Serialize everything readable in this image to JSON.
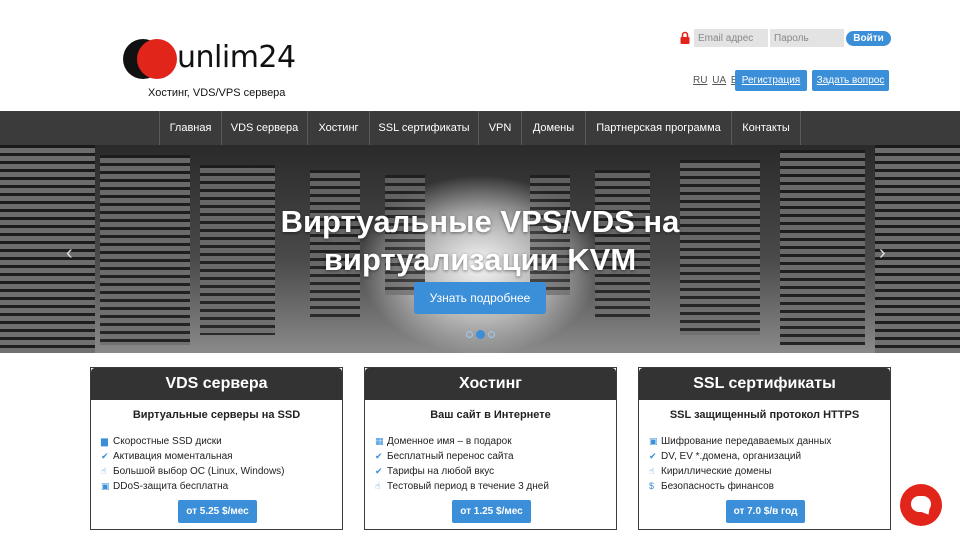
{
  "header": {
    "logo_text": "unlim24",
    "tagline": "Хостинг, VDS/VPS сервера",
    "login": {
      "email_placeholder": "Email адрес",
      "password_placeholder": "Пароль",
      "submit_label": "Войти"
    },
    "languages": [
      "RU",
      "UA",
      "EN"
    ],
    "register_label": "Регистрация",
    "ask_label": "Задать вопрос"
  },
  "nav": {
    "items": [
      "Главная",
      "VDS сервера",
      "Хостинг",
      "SSL сертификаты",
      "VPN",
      "Домены",
      "Партнерская программа",
      "Контакты"
    ]
  },
  "hero": {
    "title_line1": "Виртуальные VPS/VDS на",
    "title_line2": "виртуализации KVM",
    "button_label": "Узнать подробнее",
    "prev_icon": "‹",
    "next_icon": "›"
  },
  "cards": [
    {
      "title": "VDS сервера",
      "subtitle": "Виртуальные серверы на SSD",
      "features": [
        {
          "icon": "drive-icon",
          "glyph": "▆",
          "text": "Скоростные SSD диски"
        },
        {
          "icon": "check-icon",
          "glyph": "✔",
          "text": "Активация моментальная"
        },
        {
          "icon": "thumbs-up-icon",
          "glyph": "☝",
          "text": "Большой выбор ОС (Linux, Windows)"
        },
        {
          "icon": "lock-icon",
          "glyph": "▣",
          "text": "DDoS-защита бесплатна"
        }
      ],
      "price_label": "от 5.25 $/мес"
    },
    {
      "title": "Хостинг",
      "subtitle": "Ваш сайт в Интернете",
      "features": [
        {
          "icon": "grid-icon",
          "glyph": "▦",
          "text": "Доменное имя – в подарок"
        },
        {
          "icon": "check-icon",
          "glyph": "✔",
          "text": "Бесплатный перенос сайта"
        },
        {
          "icon": "check-icon",
          "glyph": "✔",
          "text": "Тарифы на любой вкус"
        },
        {
          "icon": "thumbs-up-icon",
          "glyph": "☝",
          "text": "Тестовый период в течение 3 дней"
        }
      ],
      "price_label": "от 1.25 $/мес"
    },
    {
      "title": "SSL сертификаты",
      "subtitle": "SSL защищенный протокол HTTPS",
      "features": [
        {
          "icon": "lock-icon",
          "glyph": "▣",
          "text": "Шифрование передаваемых данных"
        },
        {
          "icon": "check-icon",
          "glyph": "✔",
          "text": "DV, EV *.домена, организаций"
        },
        {
          "icon": "thumbs-up-icon",
          "glyph": "☝",
          "text": "Кириллические домены"
        },
        {
          "icon": "dollar-icon",
          "glyph": "$",
          "text": "Безопасность финансов"
        }
      ],
      "price_label": "от 7.0 $/в год"
    }
  ],
  "colors": {
    "accent": "#3b8ed8",
    "brand_red": "#e1251b",
    "nav_bg": "#3b3b3b"
  }
}
